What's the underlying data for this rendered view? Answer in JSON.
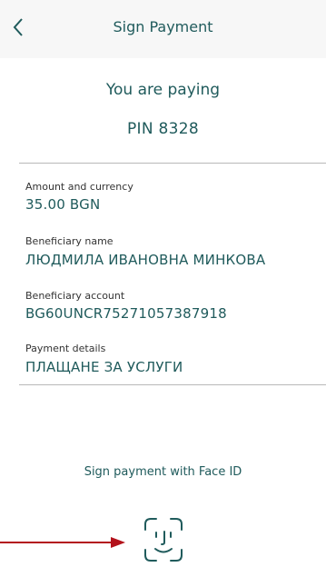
{
  "header": {
    "title": "Sign Payment",
    "back_icon": "chevron-left-icon"
  },
  "summary": {
    "paying_label": "You are paying",
    "pin_label": "PIN 8328"
  },
  "fields": [
    {
      "label": "Amount and currency",
      "value": "35.00 BGN"
    },
    {
      "label": "Beneficiary name",
      "value": "ЛЮДМИЛА ИВАНОВНА МИНКОВА"
    },
    {
      "label": "Beneficiary account",
      "value": "BG60UNCR75271057387918"
    },
    {
      "label": "Payment details",
      "value": "ПЛАЩАНЕ ЗА УСЛУГИ"
    }
  ],
  "face_id": {
    "label": "Sign payment with Face ID",
    "icon": "face-id-icon"
  },
  "annotation": {
    "icon": "red-arrow-icon",
    "color": "#b3121b"
  },
  "colors": {
    "accent": "#205b5c",
    "header_bg": "#f7f7f7"
  }
}
